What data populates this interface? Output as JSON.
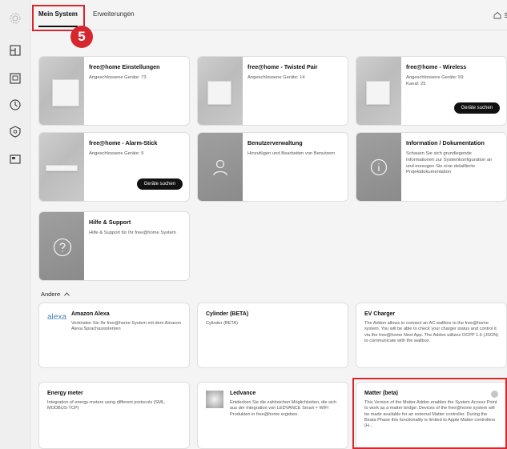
{
  "header": {
    "tabs": [
      {
        "label": "Mein System"
      },
      {
        "label": "Erweiterungen"
      }
    ],
    "step_badge": "5"
  },
  "sidebar": {
    "items": [
      {
        "icon": "gear-icon"
      },
      {
        "icon": "floorplan-icon"
      },
      {
        "icon": "panel-icon"
      },
      {
        "icon": "timer-icon"
      },
      {
        "icon": "alarm-icon"
      },
      {
        "icon": "screen-icon"
      }
    ]
  },
  "tiles": [
    {
      "title": "free@home Einstellungen",
      "subtitle": "Angeschlossene Geräte: 73"
    },
    {
      "title": "free@home - Twisted Pair",
      "subtitle": "Angeschlossene Geräte: 14"
    },
    {
      "title": "free@home - Wireless",
      "subtitle": "Angeschlossene Geräte: 59",
      "subtitle2": "Kanal: 25",
      "button": "Geräte suchen"
    },
    {
      "title": "free@home - Alarm-Stick",
      "subtitle": "Angeschlossene Geräte: 9",
      "button": "Geräte suchen"
    },
    {
      "title": "Benutzerverwaltung",
      "subtitle": "Hinzufügen und Bearbeiten von Benutzern"
    },
    {
      "title": "Information / Dokumentation",
      "subtitle": "Schauen Sie sich grundlegende Informationen zur Systemkonfiguration an und erzeugen Sie eine detaillierte Projektdokumentation"
    },
    {
      "title": "Hilfe & Support",
      "subtitle": "Hilfe & Support für Ihr free@home System"
    }
  ],
  "others": {
    "label": "Andere",
    "addons": [
      {
        "title": "Amazon Alexa",
        "subtitle": "Verbinden Sie Ihr free@home System mit dem Amazon Alexa Sprachassistenten",
        "logo": "alexa"
      },
      {
        "title": "Cylinder (BETA)",
        "subtitle": "Cylinder (BETA)"
      },
      {
        "title": "EV Charger",
        "subtitle": "The Addon allows to connect an AC wallbox to the free@home system. You will be able to check your charger status and control it via the free@home Next App. The Addon utilizes OCPP 1.6 (JSON) to communicate with the wallbox."
      },
      {
        "title": "Energy meter",
        "subtitle": "Integration of energy-meters using different protocols (SML, MODBUS-TCP)"
      },
      {
        "title": "Ledvance",
        "subtitle": "Entdecken Sie die zahlreichen Möglichkeiten, die sich aus der Integration von LEDVANCE Smart + WIFI Produkten in free@home ergeben."
      },
      {
        "title": "Matter (beta)",
        "subtitle": "This Version of the Matter Addon enables the System Access Point to work as a matter bridge: Devices of the free@home system will be made available for an external Matter controller. During the Beata Phase this functionality is limited to Apple Matter controllers (H..."
      }
    ]
  }
}
